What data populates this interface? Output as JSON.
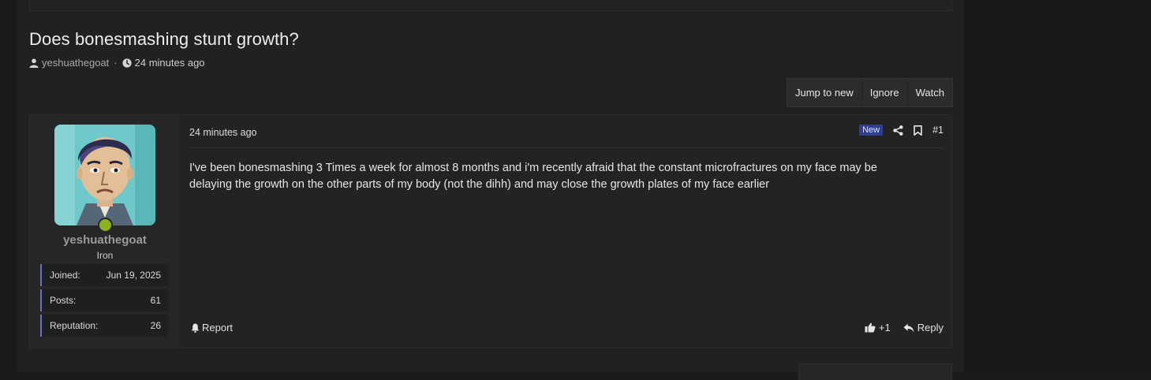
{
  "thread": {
    "title": "Does bonesmashing stunt growth?",
    "author": "yeshuathegoat",
    "separator": "·",
    "posted_ago": "24 minutes ago"
  },
  "thread_actions": {
    "jump_to_new": "Jump to new",
    "ignore": "Ignore",
    "watch": "Watch"
  },
  "post": {
    "username": "yeshuathegoat",
    "user_title": "Iron",
    "stats": [
      {
        "label": "Joined:",
        "value": "Jun 19, 2025"
      },
      {
        "label": "Posts:",
        "value": "61"
      },
      {
        "label": "Reputation:",
        "value": "26"
      }
    ],
    "time": "24 minutes ago",
    "new_badge": "New",
    "number": "#1",
    "body": "I've been bonesmashing 3 Times a week for almost 8 months and i'm recently afraid that the constant microfractures on my face may be delaying the growth on the other parts of my body (not the dihh) and may close the growth plates of my face earlier",
    "report_label": "Report",
    "like_count": "+1",
    "reply_label": "Reply"
  },
  "icons": {
    "author": "user-icon",
    "time": "clock-icon",
    "share": "share-icon",
    "bookmark": "bookmark-icon",
    "report": "bell-icon",
    "like": "thumbs-up-icon",
    "reply": "reply-icon"
  },
  "colors": {
    "page_bg": "#1b1b1b",
    "content_bg": "#212121",
    "accent_stat_border": "#6a6fd2",
    "new_badge_bg": "#2f3e8e",
    "online": "#8bb31f"
  }
}
